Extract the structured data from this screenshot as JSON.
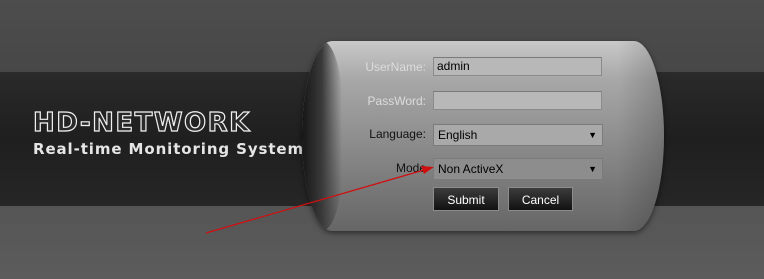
{
  "brand": {
    "title": "HD-NETWORK",
    "subtitle": "Real-time Monitoring System"
  },
  "form": {
    "username_label": "UserName:",
    "username_value": "admin",
    "password_label": "PassWord:",
    "password_value": "",
    "language_label": "Language:",
    "language_value": "English",
    "mode_label": "Mode",
    "mode_value": "Non ActiveX",
    "submit_label": "Submit",
    "cancel_label": "Cancel"
  },
  "icons": {
    "dropdown": "chevron-down-icon",
    "annotation": "red-arrow-annotation"
  },
  "colors": {
    "annotation_arrow": "#d01010",
    "panel_gradient_top": "#c9c9c9",
    "panel_gradient_bottom": "#666666"
  }
}
